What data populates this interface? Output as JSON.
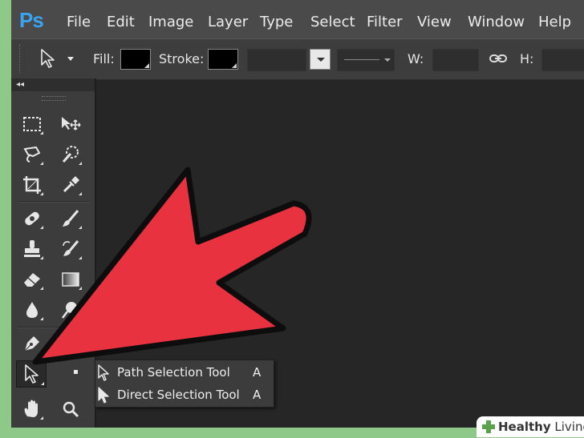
{
  "app": {
    "logo": "Ps"
  },
  "menu": [
    "File",
    "Edit",
    "Image",
    "Layer",
    "Type",
    "Select",
    "Filter",
    "View",
    "Window",
    "Help"
  ],
  "options_bar": {
    "fill_label": "Fill:",
    "stroke_label": "Stroke:",
    "width_label": "W:",
    "height_label": "H:"
  },
  "toolbox": {
    "collapse_glyph": "◂◂"
  },
  "flyout": {
    "items": [
      {
        "label": "Path Selection Tool",
        "shortcut": "A",
        "active": true
      },
      {
        "label": "Direct Selection Tool",
        "shortcut": "A",
        "active": false
      }
    ]
  },
  "watermark": {
    "bold": "Healthy",
    "regular": " Living"
  },
  "colors": {
    "arrow": "#e8323f",
    "logo": "#39a4f0",
    "canvas": "#262626",
    "background": "#8fc98a"
  }
}
